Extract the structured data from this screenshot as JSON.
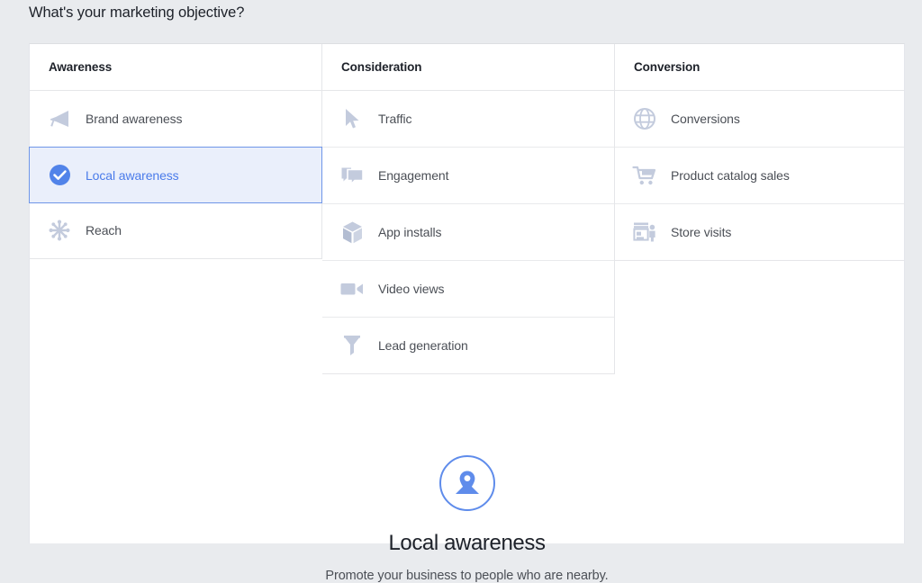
{
  "page": {
    "heading": "What's your marketing objective?",
    "background_color": "#e9ebee",
    "accent_color": "#4a7bea",
    "selected_row_bg": "#eaeffb",
    "selected_row_border": "#6f96e8",
    "icon_color": "#c3cbdd"
  },
  "columns": [
    {
      "header": "Awareness",
      "items": [
        {
          "label": "Brand awareness",
          "icon": "megaphone-icon",
          "selected": false
        },
        {
          "label": "Local awareness",
          "icon": "check-circle-icon",
          "selected": true
        },
        {
          "label": "Reach",
          "icon": "starburst-icon",
          "selected": false
        }
      ]
    },
    {
      "header": "Consideration",
      "items": [
        {
          "label": "Traffic",
          "icon": "cursor-arrow-icon",
          "selected": false
        },
        {
          "label": "Engagement",
          "icon": "speech-bubbles-icon",
          "selected": false
        },
        {
          "label": "App installs",
          "icon": "box-icon",
          "selected": false
        },
        {
          "label": "Video views",
          "icon": "video-camera-icon",
          "selected": false
        },
        {
          "label": "Lead generation",
          "icon": "funnel-icon",
          "selected": false
        }
      ]
    },
    {
      "header": "Conversion",
      "items": [
        {
          "label": "Conversions",
          "icon": "globe-icon",
          "selected": false
        },
        {
          "label": "Product catalog sales",
          "icon": "shopping-cart-icon",
          "selected": false
        },
        {
          "label": "Store visits",
          "icon": "storefront-person-icon",
          "selected": false
        }
      ]
    }
  ],
  "detail": {
    "icon": "map-pin-icon",
    "title": "Local awareness",
    "description": "Promote your business to people who are nearby."
  }
}
